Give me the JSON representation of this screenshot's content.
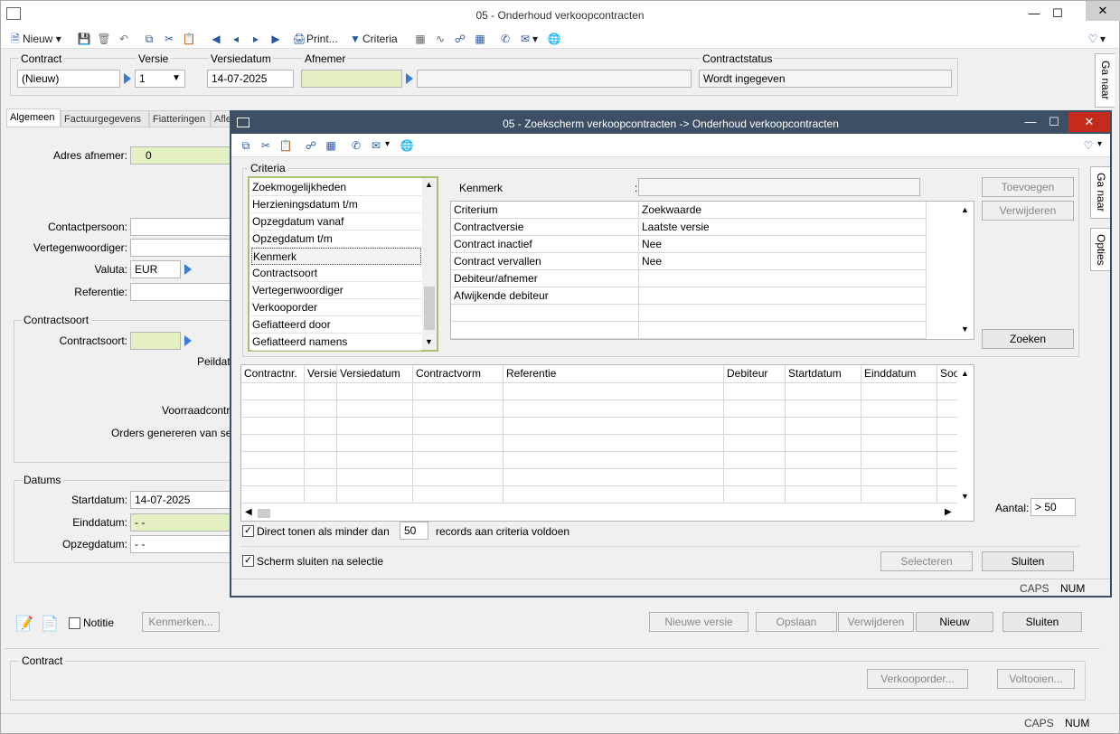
{
  "main": {
    "title": "05 - Onderhoud verkoopcontracten",
    "toolbar": {
      "new_label": "Nieuw",
      "print_label": "Print...",
      "criteria_label": "Criteria"
    },
    "header": {
      "contract_label": "Contract",
      "contract_value": "(Nieuw)",
      "versie_label": "Versie",
      "versie_value": "1",
      "versiedatum_label": "Versiedatum",
      "versiedatum_value": "14-07-2025",
      "afnemer_label": "Afnemer",
      "contractstatus_label": "Contractstatus",
      "contractstatus_value": "Wordt ingegeven"
    },
    "tabs": [
      {
        "label": "Algemeen"
      },
      {
        "label": "Factuurgegevens"
      },
      {
        "label": "Fiatteringen"
      },
      {
        "label": "Aflev"
      }
    ],
    "form": {
      "adres_afnemer_label": "Adres afnemer:",
      "adres_afnemer_value": "0",
      "contactpersoon_label": "Contactpersoon:",
      "vertegenwoordiger_label": "Vertegenwoordiger:",
      "valuta_label": "Valuta:",
      "valuta_value": "EUR",
      "referentie_label": "Referentie:",
      "contractsoort_group": "Contractsoort",
      "contractsoort_label": "Contractsoort:",
      "peildat_label": "Peildat",
      "voorraadcontr_label": "Voorraadcontr",
      "orders_label": "Orders genereren van se",
      "datums_group": "Datums",
      "startdatum_label": "Startdatum:",
      "startdatum_value": "14-07-2025",
      "einddatum_label": "Einddatum:",
      "einddatum_value": "- -",
      "opzegdatum_label": "Opzegdatum:",
      "opzegdatum_value": "- -"
    },
    "bottom": {
      "notitie_label": "Notitie",
      "kenmerken_button": "Kenmerken...",
      "nieuwe_versie_button": "Nieuwe versie",
      "opslaan_button": "Opslaan",
      "verwijderen_button": "Verwijderen",
      "nieuw_button": "Nieuw",
      "sluiten_button": "Sluiten",
      "contract_group": "Contract",
      "verkooporder_button": "Verkooporder...",
      "voltooien_button": "Voltooien..."
    },
    "side_tabs": {
      "ga_naar": "Ga naar"
    },
    "status": {
      "caps": "CAPS",
      "num": "NUM"
    }
  },
  "modal": {
    "title": "05 - Zoekscherm verkoopcontracten -> Onderhoud verkoopcontracten",
    "criteria_group": "Criteria",
    "criteria_list": [
      "Zoekmogelijkheden",
      "Herzieningsdatum t/m",
      "Opzegdatum vanaf",
      "Opzegdatum t/m",
      "Kenmerk",
      "Contractsoort",
      "Vertegenwoordiger",
      "Verkooporder",
      "Gefiatteerd door",
      "Gefiatteerd namens"
    ],
    "kenmerk_label": "Kenmerk",
    "kenmerk_colon": ":",
    "criteria_table": {
      "headers": [
        "Criterium",
        "Zoekwaarde"
      ],
      "rows": [
        [
          "Contractversie",
          "Laatste versie"
        ],
        [
          "Contract inactief",
          "Nee"
        ],
        [
          "Contract vervallen",
          "Nee"
        ],
        [
          "Debiteur/afnemer",
          ""
        ],
        [
          "Afwijkende debiteur",
          ""
        ]
      ]
    },
    "toevoegen_button": "Toevoegen",
    "verwijderen_button": "Verwijderen",
    "zoeken_button": "Zoeken",
    "results_columns": [
      "Contractnr.",
      "Versie",
      "Versiedatum",
      "Contractvorm",
      "Referentie",
      "Debiteur",
      "Startdatum",
      "Einddatum",
      "Soo"
    ],
    "aantal_label": "Aantal:",
    "aantal_value": "> 50",
    "direct_tonen_label": "Direct tonen als minder dan",
    "direct_tonen_value": "50",
    "records_label": "records aan criteria voldoen",
    "scherm_sluiten_label": "Scherm sluiten na selectie",
    "selecteren_button": "Selecteren",
    "sluiten_button": "Sluiten",
    "side_tabs": {
      "ga_naar": "Ga naar",
      "opties": "Opties"
    },
    "status": {
      "caps": "CAPS",
      "num": "NUM"
    }
  }
}
